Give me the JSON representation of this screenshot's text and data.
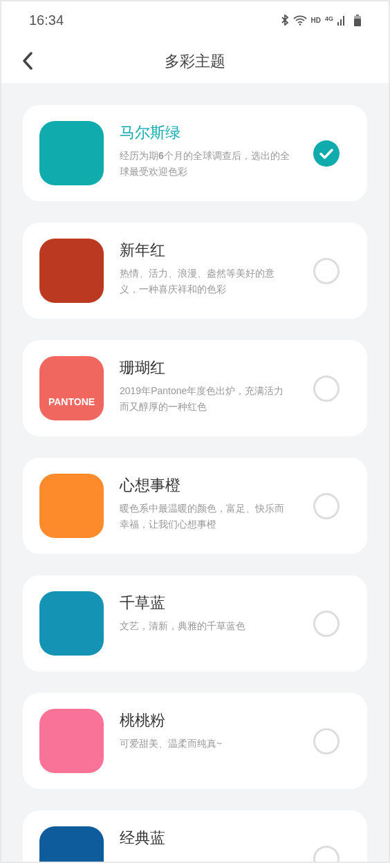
{
  "status_bar": {
    "time": "16:34",
    "hd": "HD",
    "network": "4G"
  },
  "header": {
    "title": "多彩主题"
  },
  "items": [
    {
      "title": "马尔斯绿",
      "description": "经历为期**6**个月的全球调查后，选出的全球最受欢迎色彩",
      "color": "#10abac",
      "selected": true
    },
    {
      "title": "新年红",
      "description": "热情、活力、浪漫、盎然等美好的意义，一种喜庆祥和的色彩",
      "color": "#bb3920",
      "selected": false
    },
    {
      "title": "珊瑚红",
      "description": "2019年Pantone年度色出炉，充满活力而又醇厚的一种红色",
      "color": "#ef675f",
      "badge": "PANTONE",
      "selected": false
    },
    {
      "title": "心想事橙",
      "description": "暖色系中最温暖的颜色，富足、快乐而幸福，让我们心想事橙",
      "color": "#fe8b2b",
      "selected": false
    },
    {
      "title": "千草蓝",
      "description": "文艺，清新，典雅的千草蓝色",
      "color": "#1593b5",
      "selected": false
    },
    {
      "title": "桃桃粉",
      "description": "可爱甜美、温柔而纯真~",
      "color": "#f97398",
      "selected": false
    },
    {
      "title": "经典蓝",
      "color": "#0f5c9c",
      "selected": false
    }
  ]
}
